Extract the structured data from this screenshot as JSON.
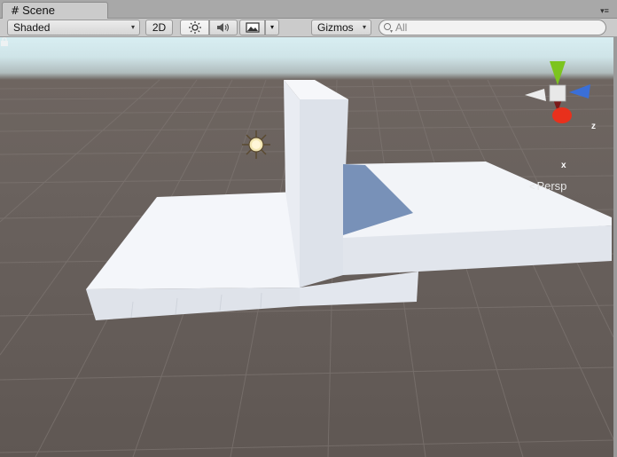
{
  "window": {
    "tab_label": "Scene",
    "tab_icon": "#",
    "menu_icon": "▾≡"
  },
  "toolbar": {
    "draw_mode": "Shaded",
    "mode_2d": "2D",
    "light_icon": "sun-icon",
    "audio_icon": "speaker-icon",
    "effects_icon": "image-icon",
    "gizmos_label": "Gizmos",
    "search_placeholder": "All",
    "dropdown_arrow": "▾"
  },
  "gizmo": {
    "axis_z": "z",
    "axis_x": "x",
    "projection": "Persp",
    "projection_icon": "<",
    "colors": {
      "x": "#e8301c",
      "y": "#7cc41f",
      "z": "#3a6fd8"
    }
  },
  "scene": {
    "object_color": "#f2f4f8",
    "ground_color": "#6a625e"
  }
}
